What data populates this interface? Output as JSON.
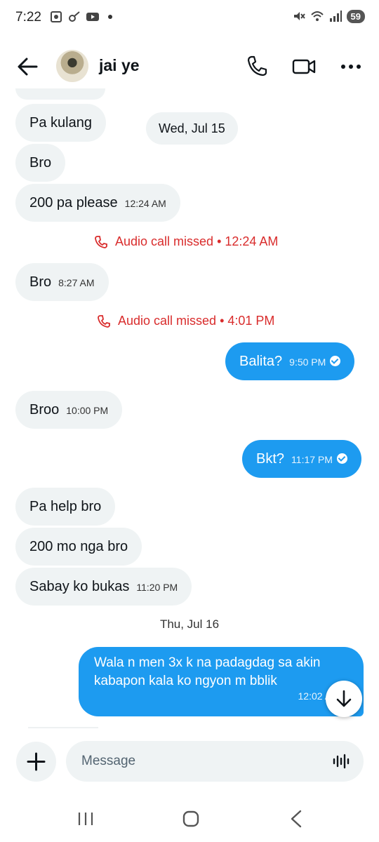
{
  "status_bar": {
    "time": "7:22",
    "battery": "59"
  },
  "header": {
    "contact_name": "jai ye"
  },
  "messages": {
    "m1": {
      "text": "Pa kulang"
    },
    "date1": "Wed, Jul 15",
    "m2": {
      "text": "Bro"
    },
    "m3": {
      "text": "200 pa please",
      "time": "12:24 AM"
    },
    "missed1": "Audio call missed • 12:24 AM",
    "m4": {
      "text": "Bro",
      "time": "8:27 AM"
    },
    "missed2": "Audio call missed • 4:01 PM",
    "m5": {
      "text": "Balita?",
      "time": "9:50 PM"
    },
    "m6": {
      "text": "Broo",
      "time": "10:00 PM"
    },
    "m7": {
      "text": "Bkt?",
      "time": "11:17 PM"
    },
    "m8": {
      "text": "Pa help bro"
    },
    "m9": {
      "text": "200 mo nga bro"
    },
    "m10": {
      "text": "Sabay ko bukas",
      "time": "11:20 PM"
    },
    "date2": "Thu, Jul 16",
    "m11": {
      "line1": "Wala n men 3x k na padagdag sa akin",
      "line2": "kabapon kala ko ngyon m bblik",
      "time": "12:02 A"
    }
  },
  "composer": {
    "placeholder": "Message"
  },
  "colors": {
    "accent": "#1d9bf0",
    "incoming_bubble": "#eff3f4",
    "missed_call": "#d92c2c"
  }
}
